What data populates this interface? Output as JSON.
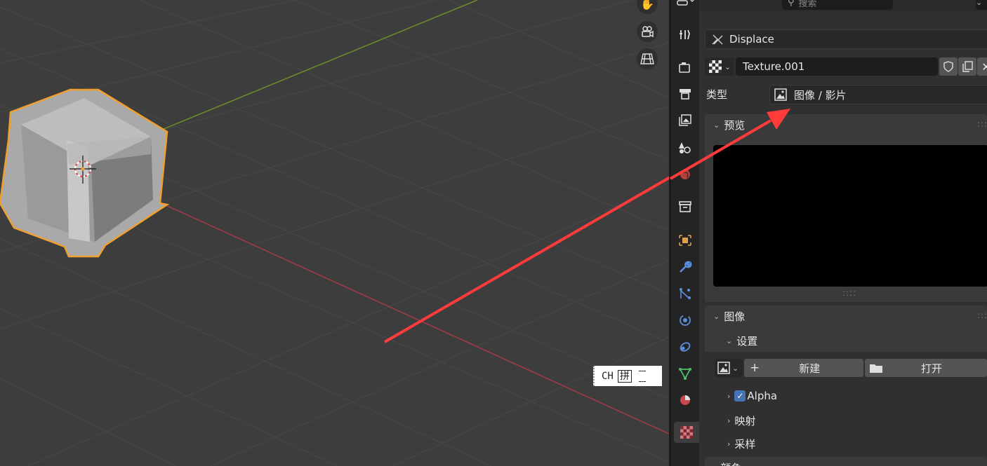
{
  "search": {
    "placeholder": "搜索"
  },
  "texture": {
    "modifier_name": "Displace",
    "name": "Texture.001",
    "type_label": "类型",
    "type_value": "图像 / 影片"
  },
  "panels": {
    "preview_title": "预览",
    "image_title": "图像",
    "settings_title": "设置",
    "new_button": "新建",
    "open_button": "打开",
    "alpha_label": "Alpha",
    "alpha_checked": true,
    "mapping_label": "映射",
    "sampling_label": "采样",
    "colors_label": "颜色"
  },
  "ime": {
    "mode": "CH",
    "pinyin": "拼"
  },
  "colors": {
    "accent": "#4772b3",
    "selection_outline": "#f0a030",
    "x_axis": "#a53b45",
    "y_axis": "#6b8f2a",
    "arrow": "#ff3b3b"
  }
}
